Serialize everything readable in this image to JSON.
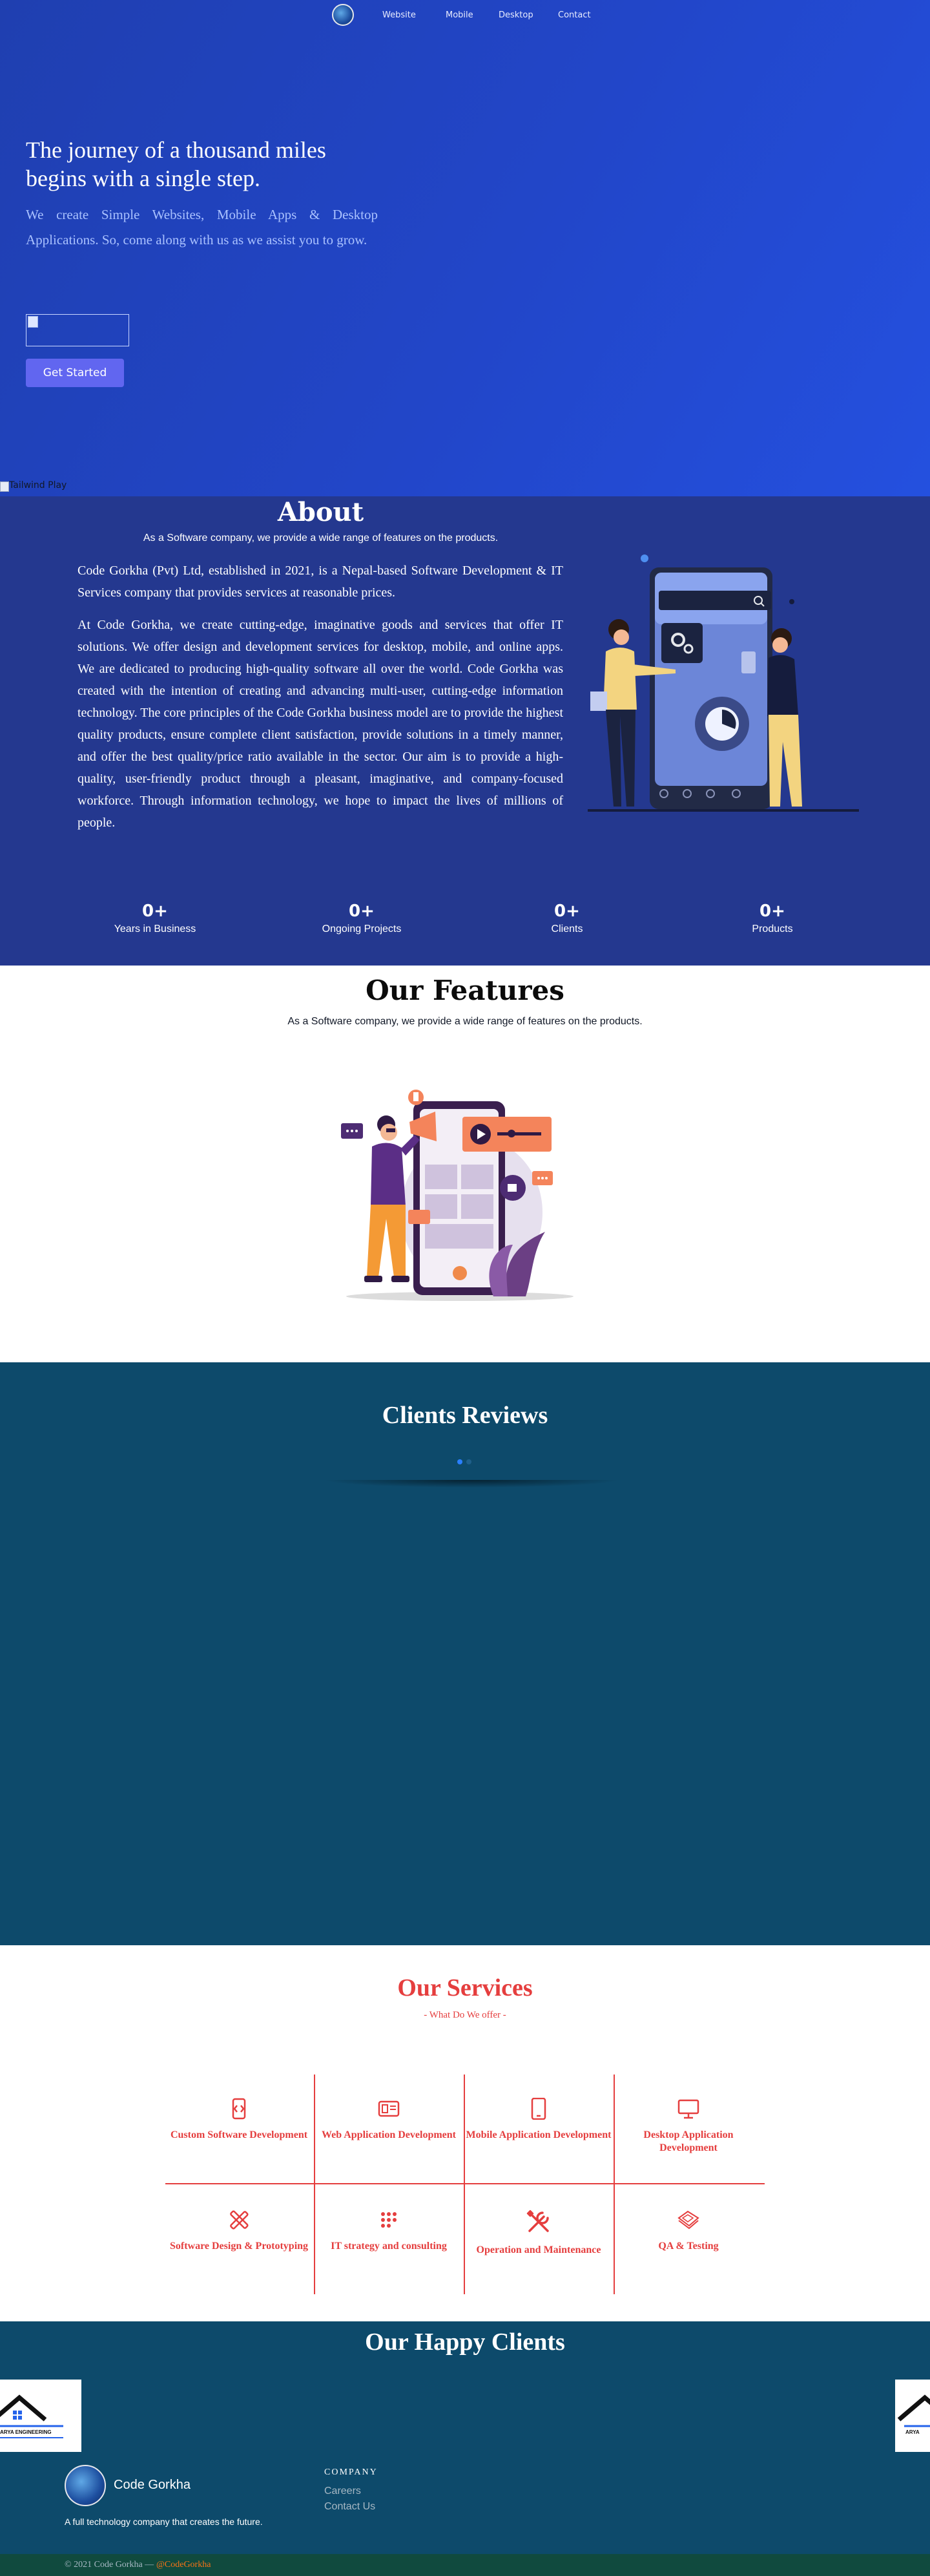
{
  "nav": {
    "links": [
      "Website",
      "Mobile",
      "Desktop",
      "Contact"
    ]
  },
  "hero": {
    "title": "The journey of a thousand miles begins with a single step.",
    "subtitle": "We create Simple Websites, Mobile Apps & Desktop Applications. So, come along with us as we assist you to grow.",
    "cta_label": "Get Started",
    "broken_image_alt": "Tailwind Play"
  },
  "about": {
    "title": "About",
    "subtitle": "As a Software company, we provide a wide range of features on the products.",
    "paragraphs": [
      "Code Gorkha (Pvt) Ltd, established in 2021, is a Nepal-based Software Development & IT Services company that provides services at reasonable prices.",
      "At Code Gorkha, we create cutting-edge, imaginative goods and services that offer IT solutions. We offer design and development services for desktop, mobile, and online apps. We are dedicated to producing high-quality software all over the world. Code Gorkha was created with the intention of creating and advancing multi-user, cutting-edge information technology. The core principles of the Code Gorkha business model are to provide the highest quality products, ensure complete client satisfaction, provide solutions in a timely manner, and offer the best quality/price ratio available in the sector. Our aim is to provide a high-quality, user-friendly product through a pleasant, imaginative, and company-focused workforce. Through information technology, we hope to impact the lives of millions of people."
    ],
    "stats": [
      {
        "value": "0+",
        "label": "Years in Business"
      },
      {
        "value": "0+",
        "label": "Ongoing Projects"
      },
      {
        "value": "0+",
        "label": "Clients"
      },
      {
        "value": "0+",
        "label": "Products"
      }
    ]
  },
  "features": {
    "title": "Our Features",
    "subtitle": "As a Software company, we provide a wide range of features on the products."
  },
  "reviews": {
    "title": "Clients Reviews"
  },
  "services": {
    "title": "Our Services",
    "subtitle": "- What Do We offer -",
    "items": [
      {
        "label": "Custom Software Development",
        "icon": "code-phone-icon"
      },
      {
        "label": "Web Application Development",
        "icon": "web-app-icon"
      },
      {
        "label": "Mobile Application Development",
        "icon": "mobile-icon"
      },
      {
        "label": "Desktop Application Development",
        "icon": "desktop-icon"
      },
      {
        "label": "Software Design & Prototyping",
        "icon": "design-tools-icon"
      },
      {
        "label": "IT strategy and consulting",
        "icon": "strategy-icon"
      },
      {
        "label": "Operation and Maintenance",
        "icon": "wrench-screwdriver-icon"
      },
      {
        "label": "QA & Testing",
        "icon": "qa-testing-icon"
      }
    ],
    "accent": "#e53e3e"
  },
  "happy_clients": {
    "title": "Our Happy Clients",
    "logo_text": "ARYA ENGINEERING"
  },
  "footer": {
    "brand": "Code Gorkha",
    "tagline": "A full technology company that creates the future.",
    "company_heading": "COMPANY",
    "links": [
      "Careers",
      "Contact Us"
    ],
    "copyright": "© 2021 Code Gorkha —",
    "handle": "@CodeGorkha"
  },
  "colors": {
    "hero_bg": "#2246c9",
    "about_bg": "#24388f",
    "reviews_bg": "#0d4a6b",
    "cta": "#6166f0",
    "copyright_bg": "#104a3e",
    "handle": "#f97316"
  }
}
